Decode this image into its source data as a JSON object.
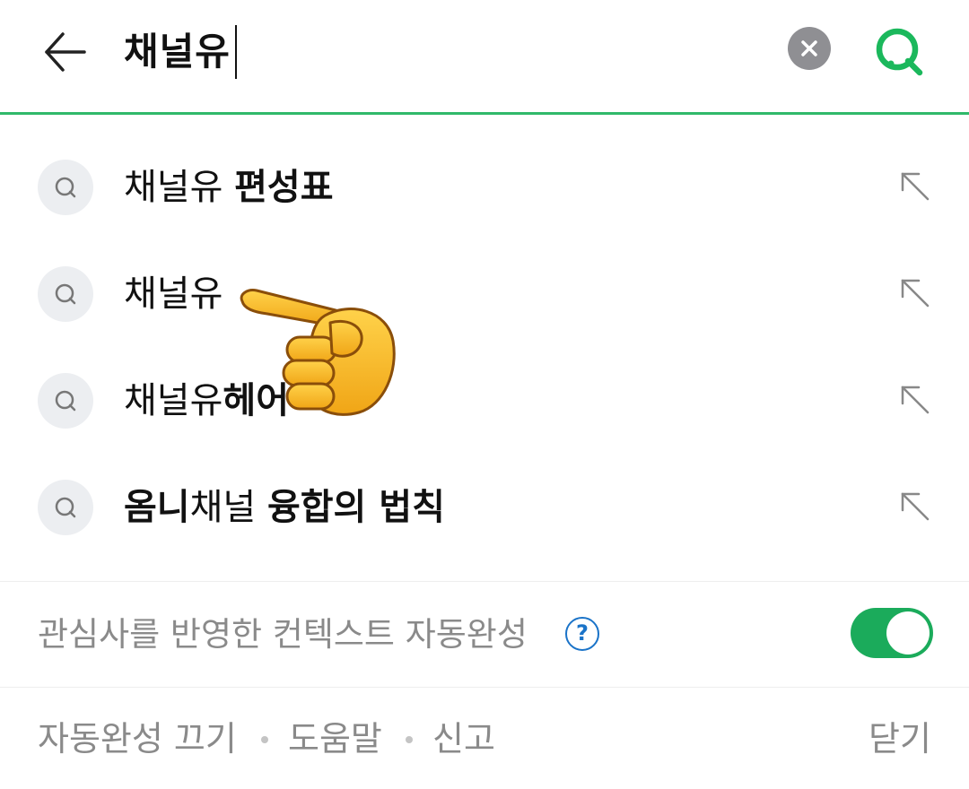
{
  "search": {
    "query": "채널유"
  },
  "suggestions": [
    {
      "prefix": "채널유 ",
      "bold": "편성표",
      "suffix": ""
    },
    {
      "prefix": "채널유",
      "bold": "",
      "suffix": ""
    },
    {
      "prefix": "채널유",
      "bold": "헤어",
      "suffix": ""
    },
    {
      "prefix": "",
      "bold": "옴니",
      "suffix": "채널 ",
      "bold2": "융합의 법칙"
    }
  ],
  "context": {
    "label": "관심사를 반영한 컨텍스트 자동완성",
    "help_glyph": "?",
    "toggle_on": true,
    "accent_color": "#1bab5b"
  },
  "footer": {
    "autocomplete_off": "자동완성 끄기",
    "help": "도움말",
    "report": "신고",
    "close": "닫기"
  },
  "colors": {
    "brand_green": "#30b96a",
    "help_blue": "#1a73c8"
  },
  "icons": {
    "back": "arrow-left-icon",
    "clear": "clear-x-icon",
    "search": "search-icon",
    "suggestion": "search-icon",
    "insert": "arrow-up-left-icon",
    "pointer": "pointing-hand-icon"
  }
}
